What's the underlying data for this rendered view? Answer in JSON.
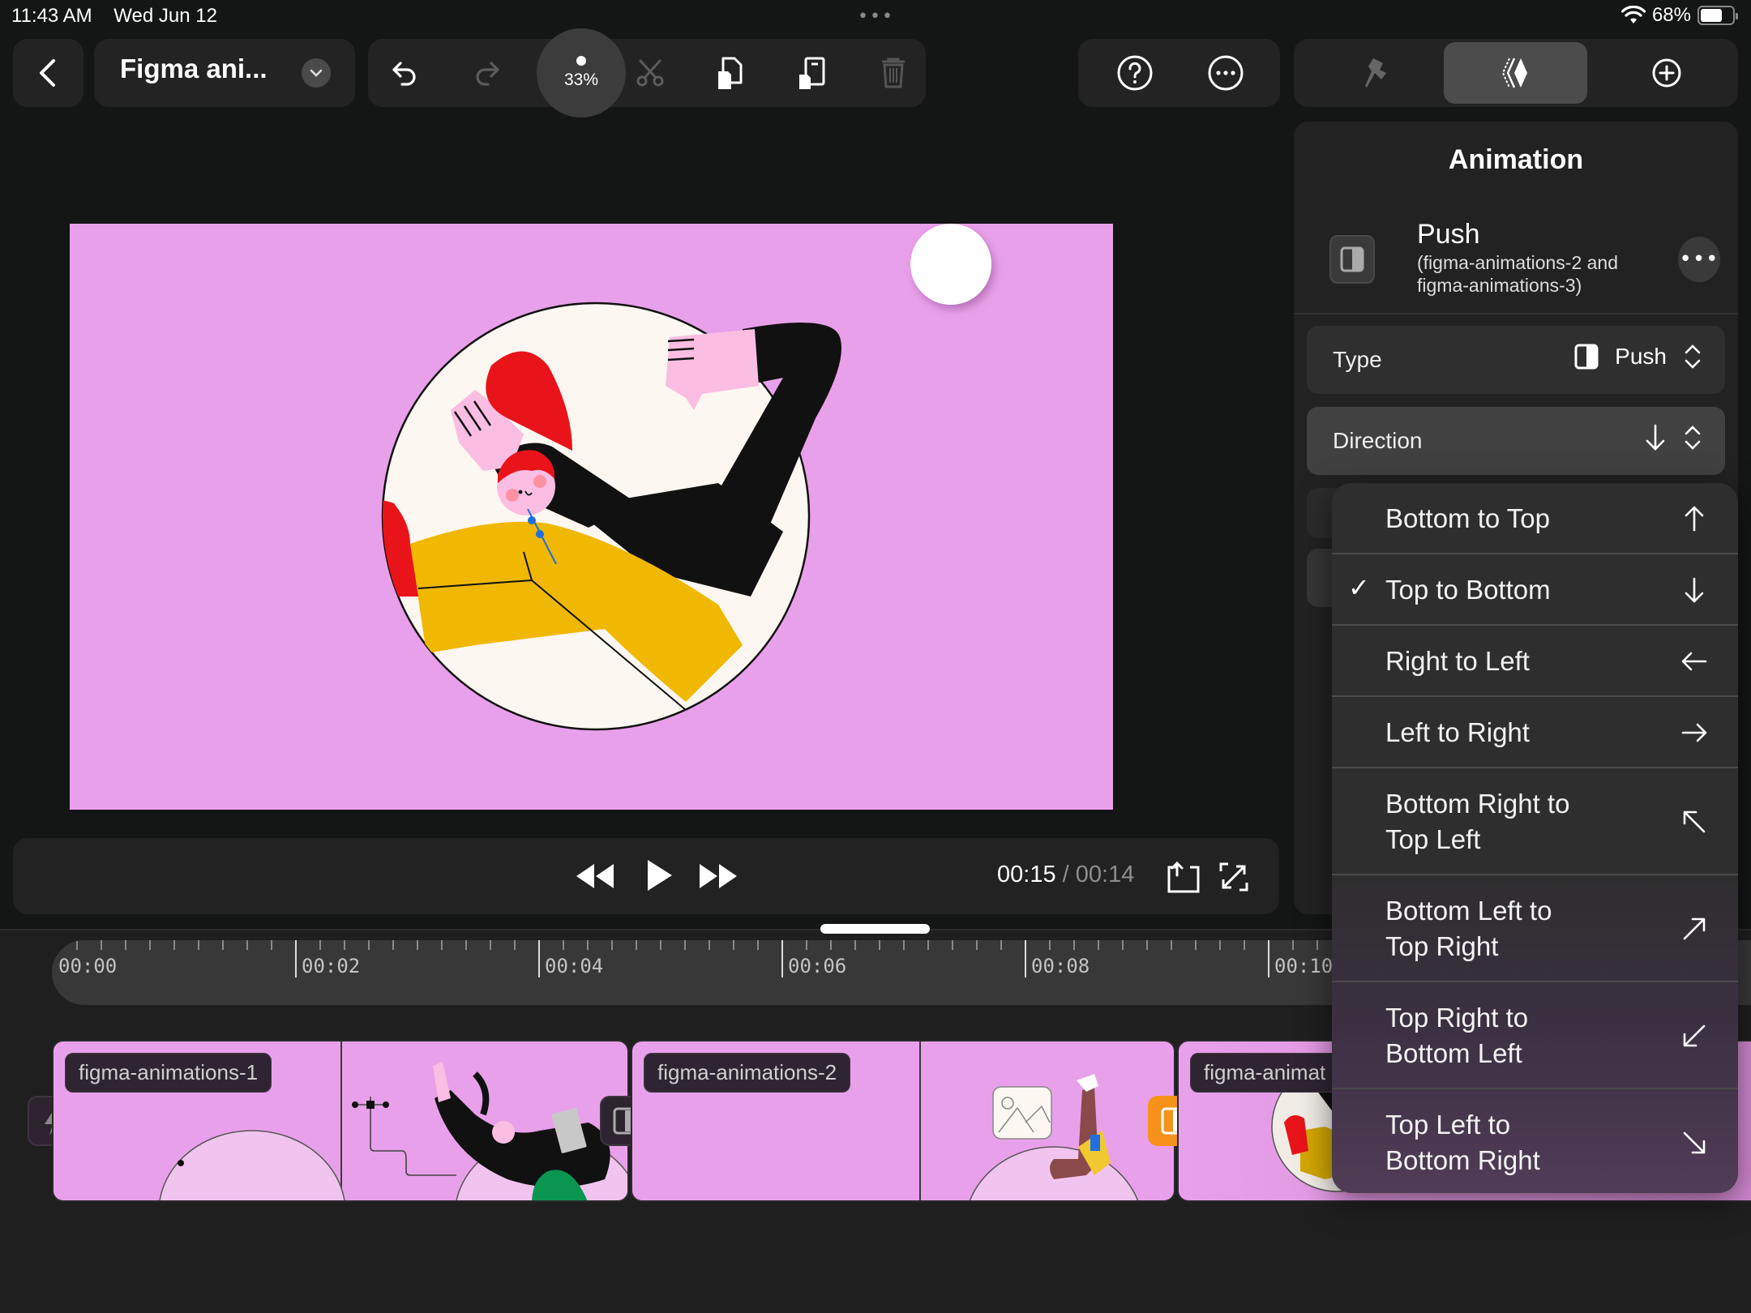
{
  "status_bar": {
    "time": "11:43 AM",
    "date": "Wed Jun 12",
    "battery_percent": "68%",
    "battery_level": 0.68
  },
  "toolbar": {
    "back_icon": "chevron-left-icon",
    "document_title": "Figma ani...",
    "title_menu_icon": "chevron-down-icon",
    "undo_icon": "undo-icon",
    "redo_icon": "redo-icon",
    "zoom_level": "33%",
    "cut_icon": "scissors-icon",
    "duplicate_icon": "duplicate-icon",
    "split_icon": "split-icon",
    "delete_icon": "trash-icon",
    "help_icon": "question-circle-icon",
    "more_icon": "ellipsis-circle-icon"
  },
  "right_tabs": [
    {
      "name": "style",
      "icon": "brush-icon",
      "active": false
    },
    {
      "name": "animation",
      "icon": "animation-diamond-icon",
      "active": true
    },
    {
      "name": "add",
      "icon": "plus-circle-icon",
      "active": false
    }
  ],
  "playback": {
    "current_time": "00:15",
    "separator": " / ",
    "total_time": "00:14",
    "rewind_icon": "rewind-icon",
    "play_icon": "play-icon",
    "forward_icon": "fast-forward-icon",
    "rotate_icon": "rotate-icon",
    "fullscreen_icon": "expand-icon"
  },
  "timeline": {
    "ticks": [
      "00:00",
      "00:02",
      "00:04",
      "00:06",
      "00:08",
      "00:10"
    ],
    "clips": [
      {
        "label": "figma-animations-1"
      },
      {
        "label": "figma-animations-2"
      },
      {
        "label": "figma-animat"
      }
    ],
    "start_trigger_icon": "lightning-icon",
    "transition_icon": "push-transition-icon"
  },
  "panel": {
    "title": "Animation",
    "animation_name": "Push",
    "animation_subtitle": "(figma-animations-2 and figma-animations-3)",
    "more_label": "•••",
    "rows": [
      {
        "label": "Type",
        "value": "Push",
        "icon": "push-icon",
        "stepper_icon": "chevron-up-down-icon"
      },
      {
        "label": "Direction",
        "value_icon": "arrow-down-icon",
        "stepper_icon": "chevron-up-down-icon"
      }
    ]
  },
  "direction_menu": {
    "selected_index": 1,
    "check_mark": "✓",
    "options": [
      {
        "label": "Bottom to Top",
        "icon": "arrow-up-icon"
      },
      {
        "label": "Top to Bottom",
        "icon": "arrow-down-icon"
      },
      {
        "label": "Right to Left",
        "icon": "arrow-left-icon"
      },
      {
        "label": "Left to Right",
        "icon": "arrow-right-icon"
      },
      {
        "label": "Bottom Right to Top Left",
        "icon": "arrow-up-left-icon"
      },
      {
        "label": "Bottom Left to Top Right",
        "icon": "arrow-up-right-icon"
      },
      {
        "label": "Top Right to Bottom Left",
        "icon": "arrow-down-left-icon"
      },
      {
        "label": "Top Left to Bottom Right",
        "icon": "arrow-down-right-icon"
      }
    ]
  },
  "colors": {
    "canvas_bg": "#e9a0ea",
    "accent_orange": "#f7931a",
    "panel_bg": "#222222"
  }
}
